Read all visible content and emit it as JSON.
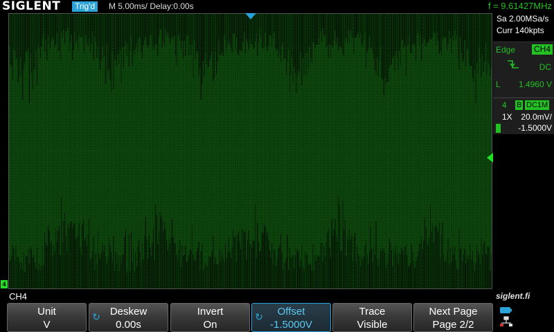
{
  "topbar": {
    "logo": "SIGLENT",
    "trigger_status": "Trig'd",
    "timebase": "M 5.00ms/ Delay:0.00s",
    "frequency": "f = 9.61427MHz"
  },
  "acquisition": {
    "sample_rate": "Sa 2.00MSa/s",
    "memory": "Curr 140kpts"
  },
  "trigger": {
    "type": "Edge",
    "source": "CH4",
    "coupling": "DC",
    "slope_icon": "falling-edge-icon",
    "level_prefix": "L",
    "level": "1.4960 V"
  },
  "channel": {
    "number": "4",
    "bw_limit": "B",
    "coupling": "DC1M",
    "probe": "1X",
    "scale": "20.0mV/",
    "offset": "-1.5000V",
    "color": "#22c022"
  },
  "markers": {
    "channel_ground": "4"
  },
  "menu": {
    "title": "CH4",
    "brand": "siglent.fi",
    "softkeys": [
      {
        "label": "Unit",
        "value": "V"
      },
      {
        "label": "Deskew",
        "value": "0.00s"
      },
      {
        "label": "Invert",
        "value": "On"
      },
      {
        "label": "Offset",
        "value": "-1.5000V"
      },
      {
        "label": "Trace",
        "value": "Visible"
      },
      {
        "label": "Next Page",
        "value": "Page 2/2"
      }
    ]
  },
  "colors": {
    "accent": "#2aa4d8",
    "channel": "#22c022",
    "waveform_fill": "#0a3b0a"
  }
}
